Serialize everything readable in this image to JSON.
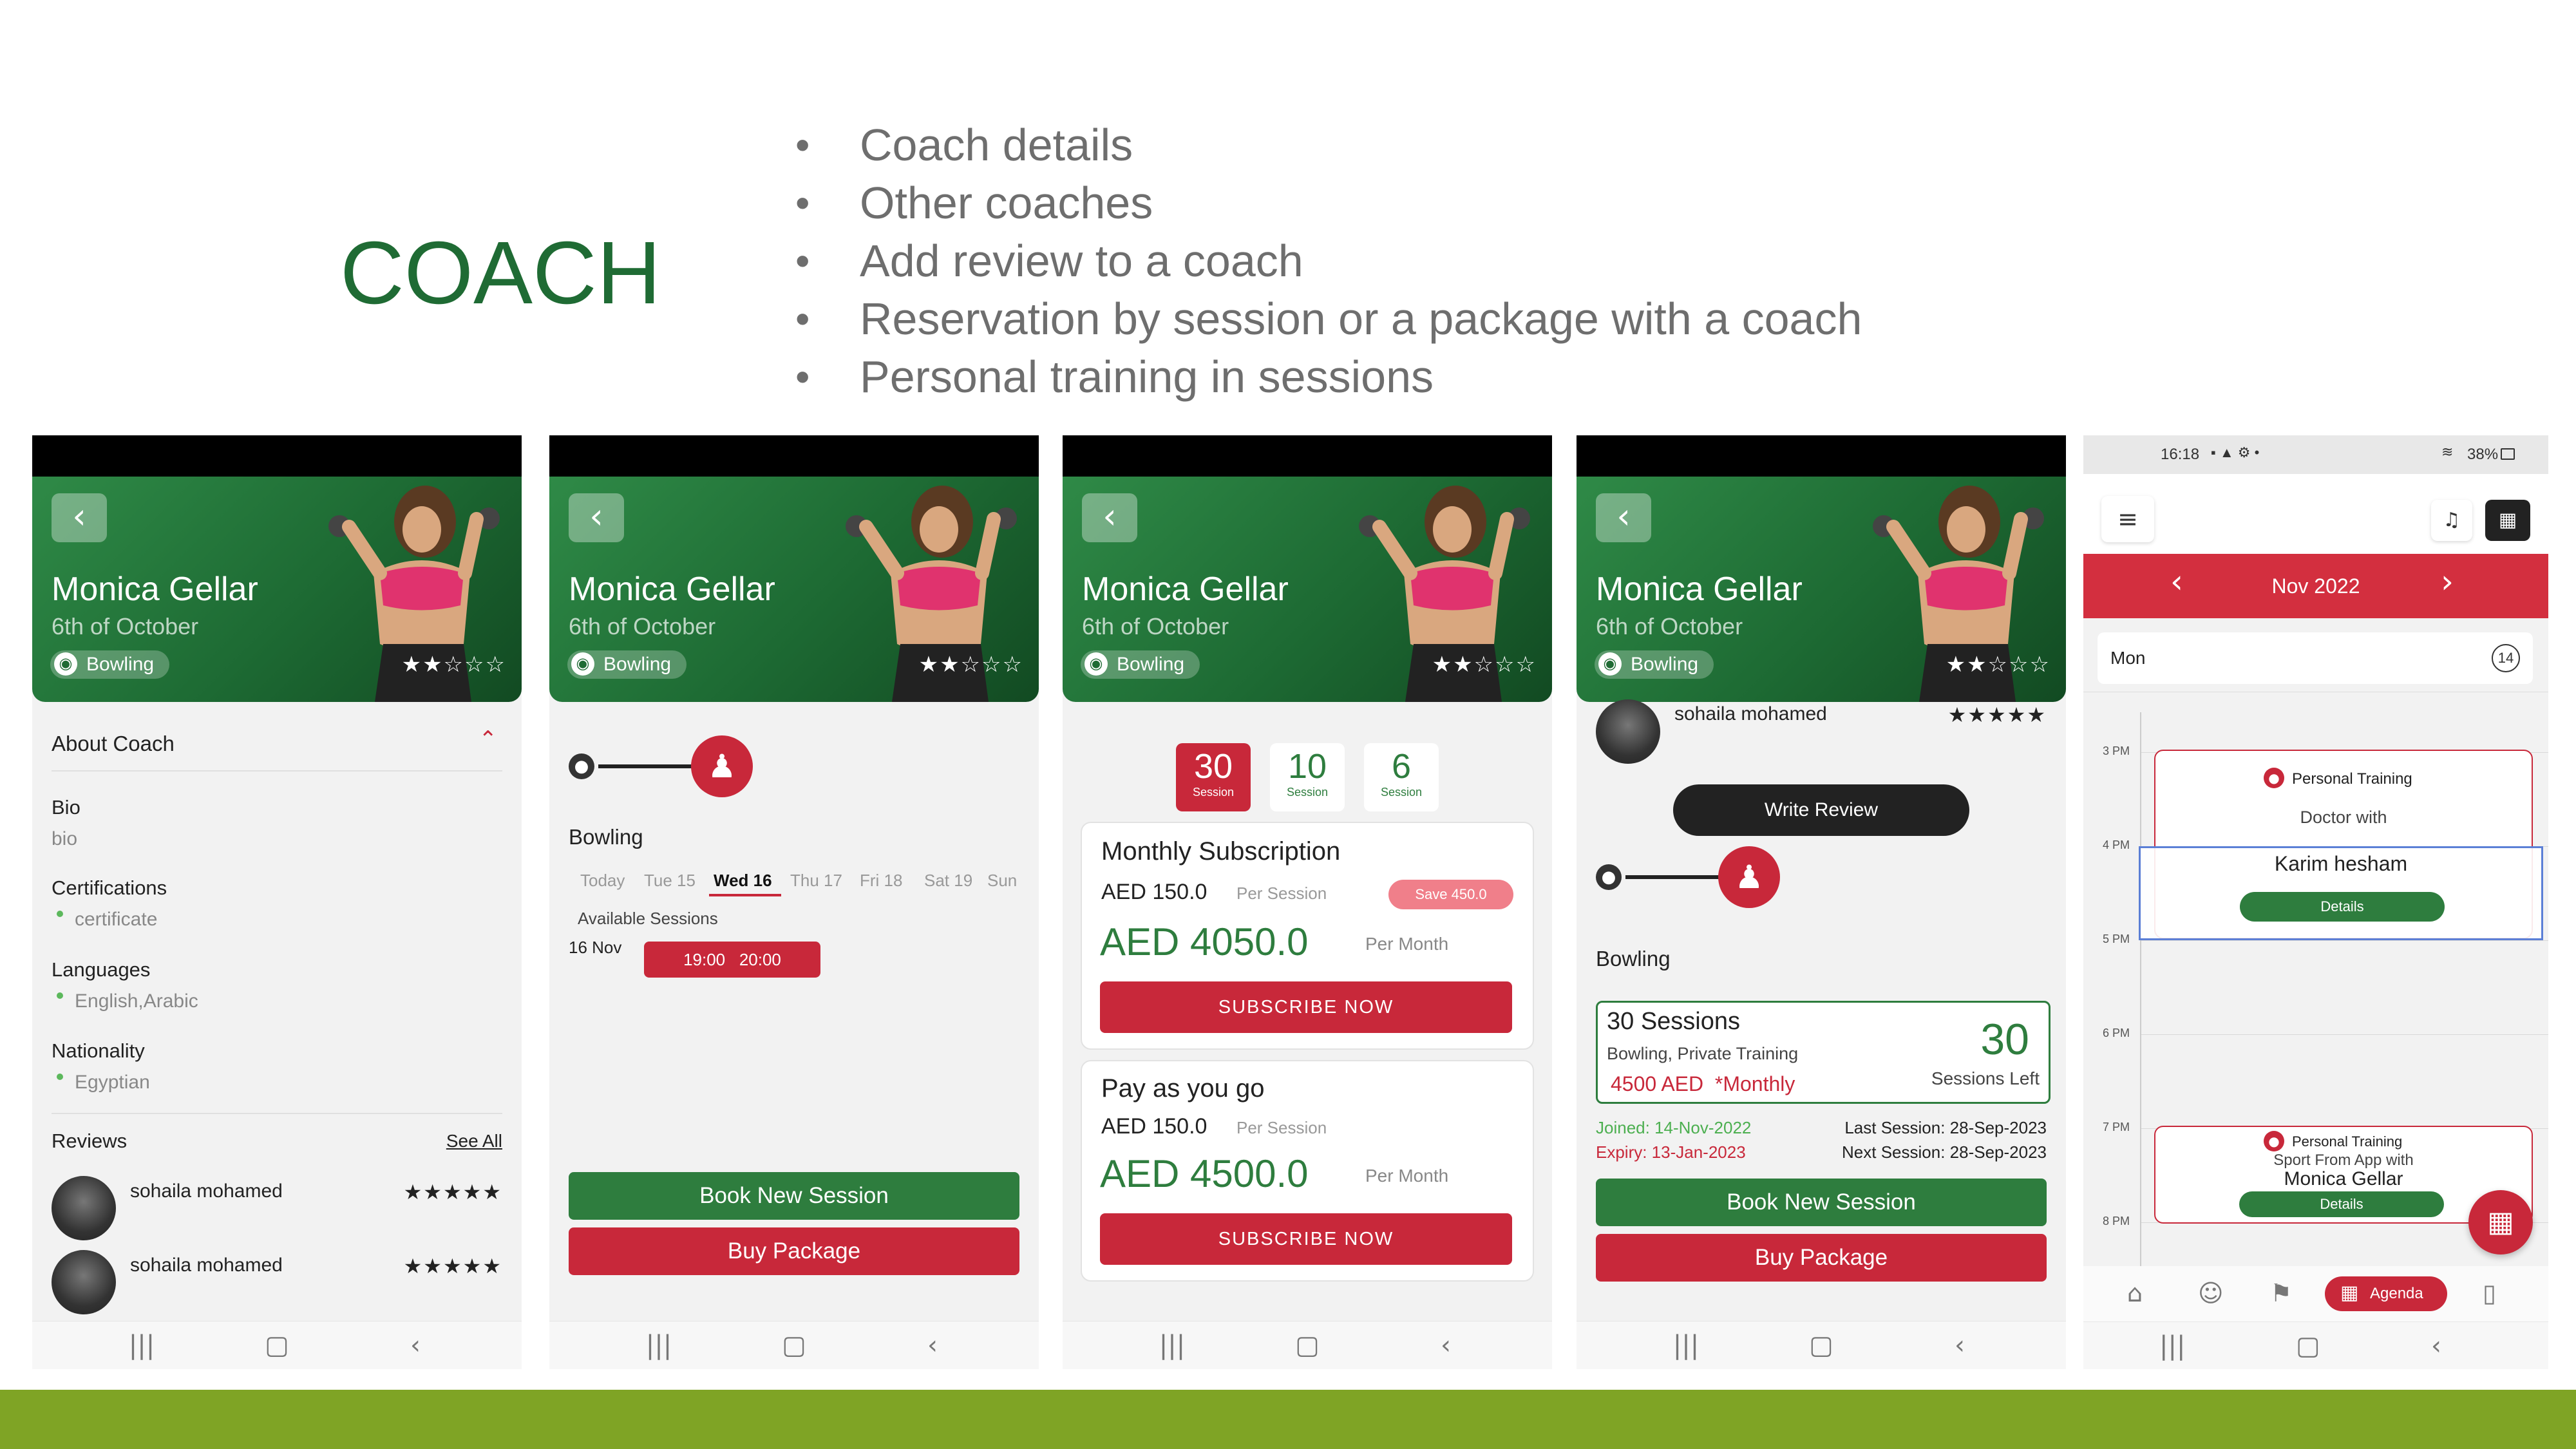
{
  "slide": {
    "title": "COACH",
    "bullets": [
      "Coach details",
      "Other coaches",
      "Add review to a coach",
      "Reservation by session or a package with a coach",
      "Personal training in sessions"
    ],
    "accent_color": "#1f6b34",
    "footer_color": "#7fa425"
  },
  "coach": {
    "name": "Monica Gellar",
    "location": "6th of October",
    "sport": "Bowling",
    "rating_stars": "★★☆☆☆"
  },
  "screen1": {
    "about_label": "About Coach",
    "bio_label": "Bio",
    "bio_value": "bio",
    "certifications_label": "Certifications",
    "certifications_value": "certificate",
    "languages_label": "Languages",
    "languages_value": "English,Arabic",
    "nationality_label": "Nationality",
    "nationality_value": "Egyptian",
    "reviews_label": "Reviews",
    "see_all": "See All",
    "reviews": [
      {
        "name": "sohaila mohamed",
        "stars": "★★★★★"
      },
      {
        "name": "sohaila mohamed",
        "stars": "★★★★★"
      }
    ]
  },
  "screen2": {
    "sport_label": "Bowling",
    "days": [
      "Today",
      "Tue 15",
      "Wed 16",
      "Thu 17",
      "Fri 18",
      "Sat 19",
      "Sun"
    ],
    "selected_day": "Wed 16",
    "available_label": "Available Sessions",
    "date_label": "16 Nov",
    "slot_start": "19:00",
    "slot_end": "20:00",
    "book_btn": "Book New Session",
    "buy_btn": "Buy Package"
  },
  "screen3": {
    "session_tabs": [
      {
        "num": "30",
        "unit": "Session"
      },
      {
        "num": "10",
        "unit": "Session"
      },
      {
        "num": "6",
        "unit": "Session"
      }
    ],
    "monthly": {
      "title": "Monthly Subscription",
      "per_session_price": "AED 150.0",
      "per_session_label": "Per Session",
      "save_badge": "Save 450.0",
      "total": "AED 4050.0",
      "per_month": "Per Month",
      "subscribe": "SUBSCRIBE NOW"
    },
    "payg": {
      "title": "Pay as you go",
      "per_session_price": "AED 150.0",
      "per_session_label": "Per Session",
      "total": "AED 4500.0",
      "per_month": "Per Month",
      "subscribe": "SUBSCRIBE NOW"
    }
  },
  "screen4": {
    "review_name": "sohaila mohamed",
    "review_stars": "★★★★★",
    "write_review": "Write Review",
    "sport_label": "Bowling",
    "package_title": "30 Sessions",
    "package_sub": "Bowling, Private Training",
    "package_price": "4500 AED",
    "package_period": "*Monthly",
    "sessions_left_num": "30",
    "sessions_left_label": "Sessions Left",
    "joined": "Joined: 14-Nov-2022",
    "expiry": "Expiry: 13-Jan-2023",
    "last_session": "Last Session: 28-Sep-2023",
    "next_session": "Next Session: 28-Sep-2023",
    "book_btn": "Book New Session",
    "buy_btn": "Buy Package"
  },
  "screen5": {
    "status_time": "16:18",
    "status_icons": "▪ ▲ ⚙ •",
    "status_right": "38%",
    "month": "Nov 2022",
    "day_label": "Mon",
    "day_num": "14",
    "hours": [
      "3 PM",
      "4 PM",
      "5 PM",
      "6 PM",
      "7 PM",
      "8 PM"
    ],
    "event1": {
      "type": "Personal Training",
      "line": "Doctor  with",
      "name": "Karim hesham",
      "details": "Details"
    },
    "event2": {
      "type": "Personal Training",
      "line": "Sport From App  with",
      "name": "Monica Gellar",
      "details": "Details"
    },
    "agenda_label": "Agenda"
  },
  "colors": {
    "green": "#2e7d3e",
    "red": "#c8283a"
  }
}
